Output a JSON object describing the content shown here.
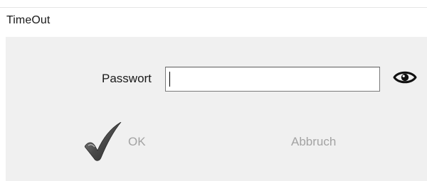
{
  "window": {
    "title": "TimeOut"
  },
  "form": {
    "password_label": "Passwort",
    "password_value": "",
    "show_password_icon": "eye-icon"
  },
  "buttons": {
    "ok_label": "OK",
    "ok_icon": "checkmark-icon",
    "cancel_label": "Abbruch"
  },
  "colors": {
    "dialog_background": "#f0f0f0",
    "disabled_text": "#a3a3a3"
  }
}
